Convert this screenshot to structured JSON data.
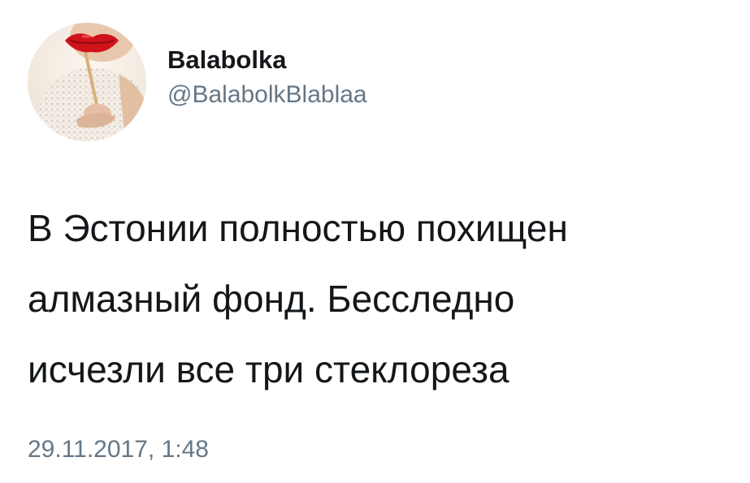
{
  "author": {
    "display_name": "Balabolka",
    "handle": "@BalabolkBlablaa"
  },
  "tweet": {
    "lines": [
      "В Эстонии полностью похищен",
      "алмазный фонд. Бесследно",
      "исчезли все три стеклореза"
    ],
    "timestamp": "29.11.2017, 1:48"
  },
  "colors": {
    "text": "#14171a",
    "secondary": "#657786",
    "lips": "#d0121b"
  },
  "icons": {
    "avatar": "profile-photo"
  }
}
